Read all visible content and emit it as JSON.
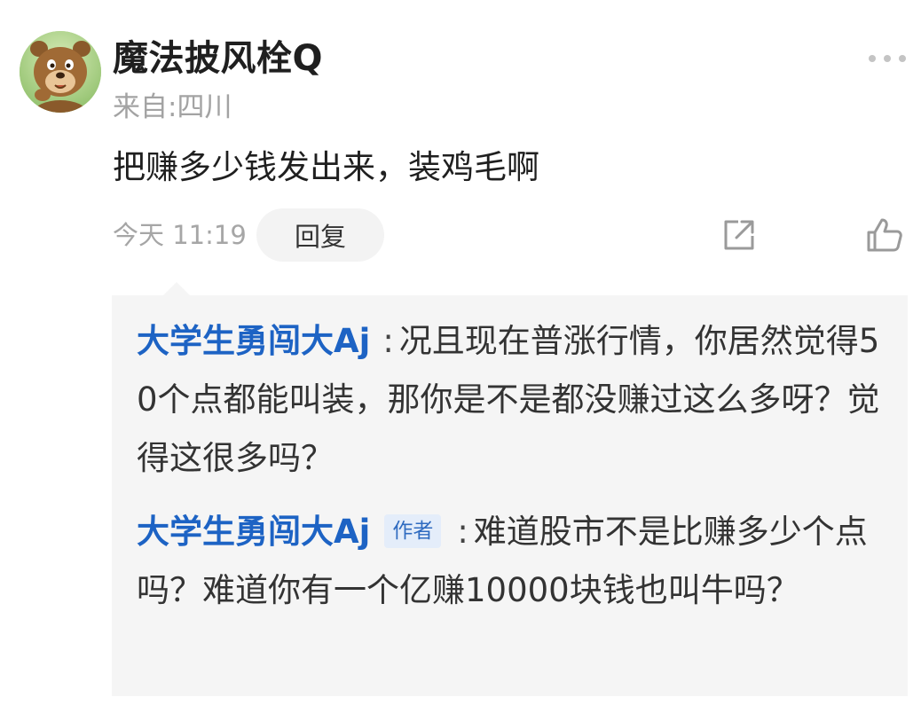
{
  "comment": {
    "username": "魔法披风栓Q",
    "location": "来自:四川",
    "text": "把赚多少钱发出来，装鸡毛啊",
    "timestamp": "今天 11:19",
    "reply_label": "回复",
    "icons": {
      "more": "more-dots-icon",
      "share": "share-icon",
      "like": "thumbs-up-icon"
    },
    "avatar": "cartoon-bear-avatar"
  },
  "replies": [
    {
      "author": "大学生勇闯大Aj",
      "badge": "",
      "colon": ":",
      "text": "况且现在普涨行情，你居然觉得50个点都能叫装，那你是不是都没赚过这么多呀？觉得这很多吗？"
    },
    {
      "author": "大学生勇闯大Aj",
      "badge": "作者",
      "colon": ":",
      "text": "难道股市不是比赚多少个点吗？难道你有一个亿赚10000块钱也叫牛吗？"
    }
  ],
  "colors": {
    "author_link": "#1d63c4",
    "badge_bg": "#e4edfa",
    "reply_box_bg": "#f5f5f5",
    "muted_text": "#a6a6a6"
  }
}
